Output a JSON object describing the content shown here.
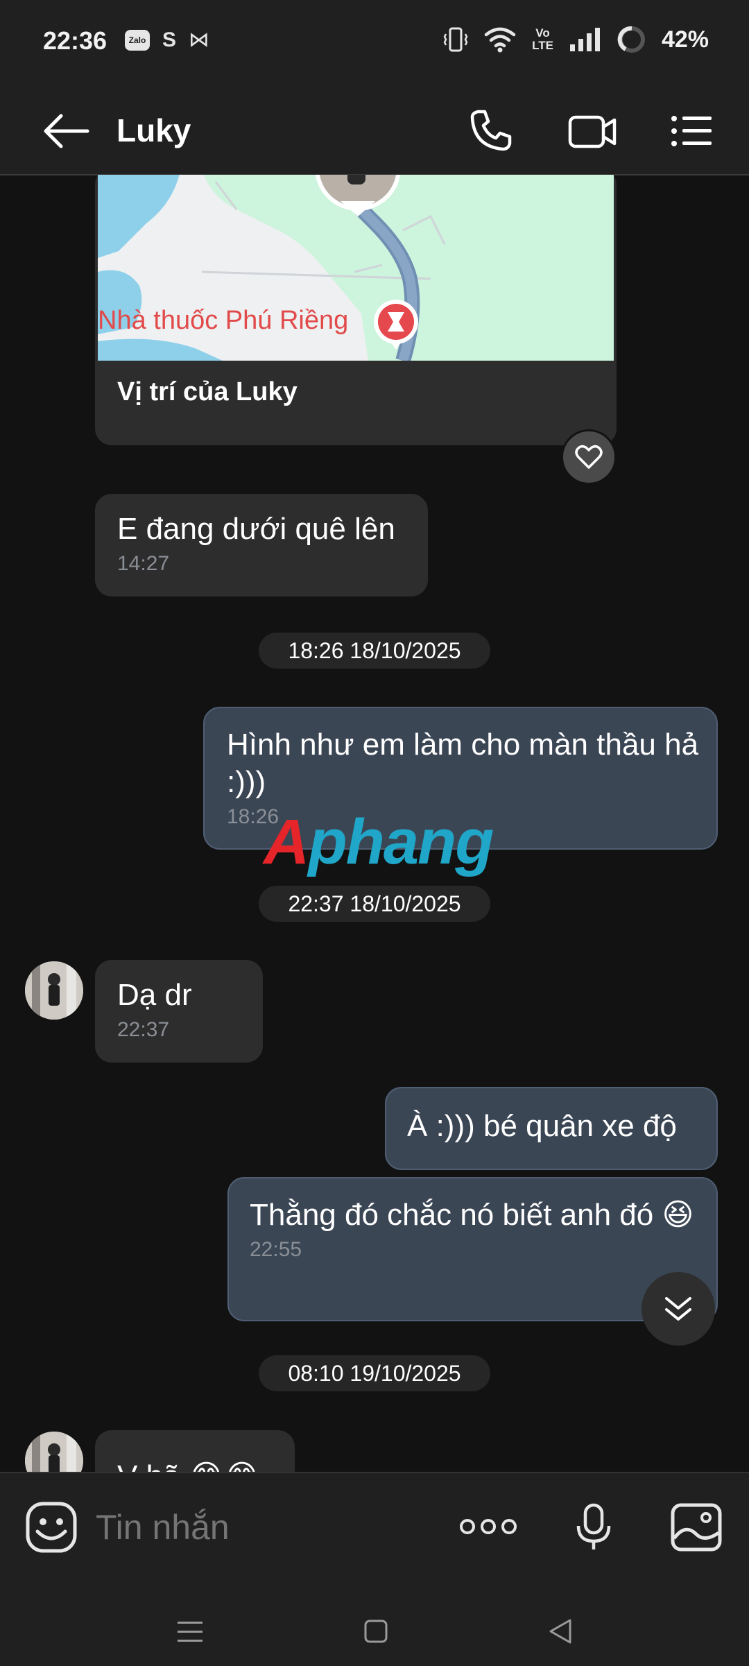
{
  "status_bar": {
    "time": "22:36",
    "left_icons": [
      "zalo-icon",
      "s-app-icon",
      "capcut-icon"
    ],
    "zalo_label": "Zalo",
    "s_label": "S",
    "capcut_glyph": "⋈",
    "volte_top": "Vo",
    "volte_bottom": "LTE",
    "battery_percent": "42%"
  },
  "header": {
    "contact_name": "Luky",
    "actions": [
      "call-icon",
      "video-call-icon",
      "menu-icon"
    ]
  },
  "messages": {
    "location": {
      "pharmacy_label": "Nhà thuốc Phú Riềng",
      "title": "Vị trí của Luky",
      "reaction_icon": "heart-icon"
    },
    "m1": {
      "text": "E đang dưới quê lên",
      "time": "14:27"
    },
    "date1": "18:26 18/10/2025",
    "m2": {
      "text": "Hình như em làm cho màn thầu hả :)))",
      "time": "18:26"
    },
    "date2": "22:37 18/10/2025",
    "m3": {
      "text": "Dạ dr",
      "time": "22:37"
    },
    "m4": {
      "text": "À :))) bé quân xe độ"
    },
    "m5": {
      "text": "Thằng đó chắc nó biết anh đó 😆",
      "time": "22:55"
    },
    "date3": "08:10 19/10/2025",
    "m6": {
      "text": "V hã 😂😂"
    }
  },
  "watermark": {
    "first": "A",
    "rest": "phang"
  },
  "composer": {
    "placeholder": "Tin nhắn",
    "icons": [
      "emoji-icon",
      "more-icon",
      "mic-icon",
      "gallery-icon"
    ]
  },
  "nav_bar": [
    "recent-apps-icon",
    "home-icon",
    "back-icon"
  ],
  "colors": {
    "background": "#121212",
    "incoming_bubble": "#2d2d2d",
    "outgoing_bubble": "#3b4655",
    "bars": "#202020"
  }
}
